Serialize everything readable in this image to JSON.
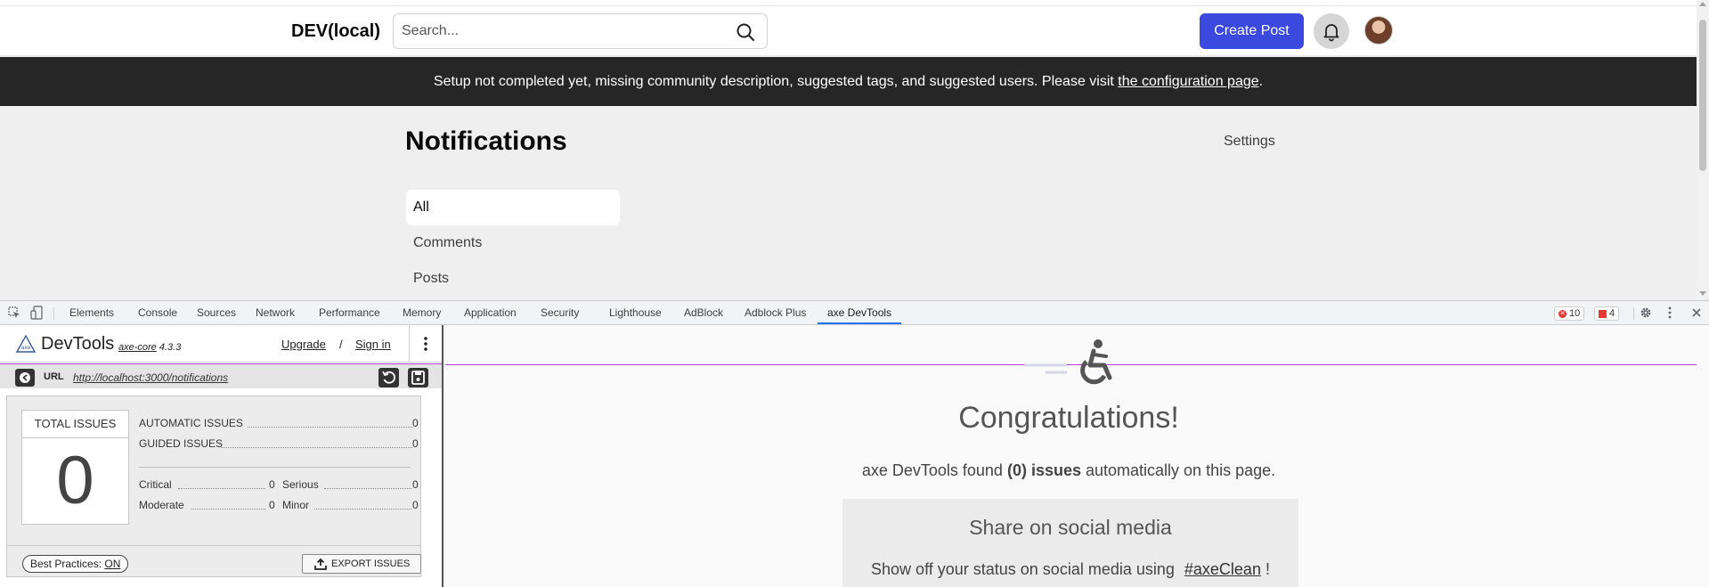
{
  "header": {
    "logo": "DEV(local)",
    "search_placeholder": "Search...",
    "create_post_label": "Create Post"
  },
  "banner": {
    "text": "Setup not completed yet, missing community description, suggested tags, and suggested users. Please visit ",
    "link_text": "the configuration page",
    "suffix": "."
  },
  "main": {
    "title": "Notifications",
    "settings_label": "Settings",
    "nav": [
      {
        "label": "All",
        "active": true
      },
      {
        "label": "Comments",
        "active": false
      },
      {
        "label": "Posts",
        "active": false
      }
    ]
  },
  "devtools": {
    "tabs": [
      "Elements",
      "Console",
      "Sources",
      "Network",
      "Performance",
      "Memory",
      "Application",
      "Security",
      "Lighthouse",
      "AdBlock",
      "Adblock Plus",
      "axe DevTools"
    ],
    "active_tab": "axe DevTools",
    "error_count": "10",
    "issue_count": "4"
  },
  "axe": {
    "title": "DevTools",
    "core_label": "axe-core",
    "core_version": "4.3.3",
    "upgrade_label": "Upgrade",
    "separator": "/",
    "signin_label": "Sign in",
    "url_label": "URL",
    "url_value": "http://localhost:3000/notifications",
    "total_issues_label": "TOTAL ISSUES",
    "total_issues_value": "0",
    "automatic_label": "AUTOMATIC ISSUES",
    "automatic_value": "0",
    "guided_label": "GUIDED ISSUES",
    "guided_value": "0",
    "critical_label": "Critical",
    "critical_value": "0",
    "serious_label": "Serious",
    "serious_value": "0",
    "moderate_label": "Moderate",
    "moderate_value": "0",
    "minor_label": "Minor",
    "minor_value": "0",
    "best_practices_label": "Best Practices:",
    "best_practices_state": "ON",
    "export_label": "EXPORT ISSUES",
    "congrats": "Congratulations!",
    "found_prefix": "axe DevTools found ",
    "found_bold": "(0) issues",
    "found_suffix": " automatically on this page.",
    "share_title": "Share on social media",
    "share_text": "Show off your status on social media using ",
    "share_tag": "#axeClean",
    "share_suffix": " !"
  },
  "colors": {
    "brand_button": "#3b49df",
    "banner_bg": "#262626",
    "axe_accent": "#b83bd6",
    "devtools_active_tab": "#1a73e8"
  },
  "icons": [
    "search-icon",
    "bell-icon",
    "avatar",
    "inspect-icon",
    "device-toolbar-icon",
    "error-icon",
    "issue-flag-icon",
    "gear-icon",
    "kebab-icon",
    "close-icon",
    "axe-logo-icon",
    "back-arrow-icon",
    "refresh-icon",
    "save-icon",
    "export-icon",
    "accessibility-icon"
  ]
}
